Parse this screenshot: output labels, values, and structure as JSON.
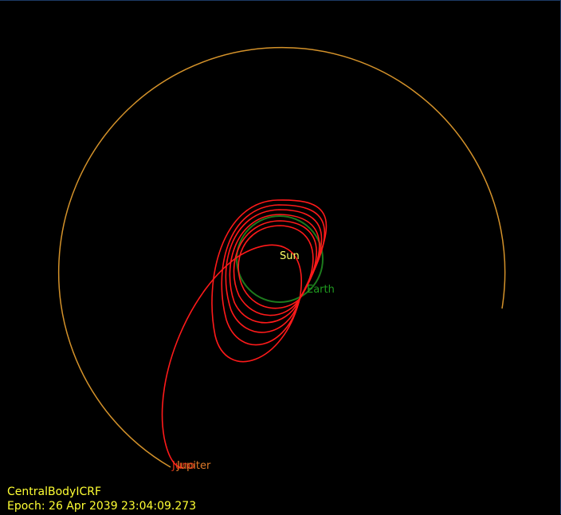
{
  "scene": {
    "labels": {
      "sun": "Sun",
      "earth": "Earth",
      "jupiter": "Jupiter",
      "spacecraft": "Juno"
    },
    "colors": {
      "background": "#000000",
      "jupiter_orbit": "#d4922a",
      "earth_orbit": "#1d7a1d",
      "trajectory": "#ff1a1a",
      "sun_label": "#ffff66",
      "earth_label": "#1f9a1f",
      "jupiter_label": "#e07a2a",
      "spacecraft_label": "#ff3b1a",
      "hud_text": "#ffff33"
    }
  },
  "hud": {
    "reference_frame": "CentralBodyICRF",
    "epoch": "Epoch: 26 Apr 2039 23:04:09.273"
  }
}
